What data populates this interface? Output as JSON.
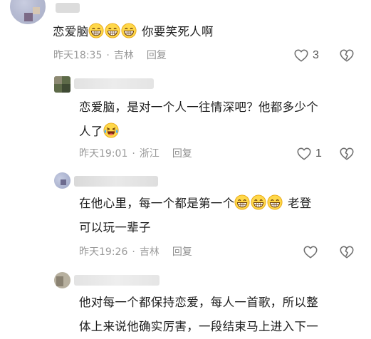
{
  "comments": [
    {
      "content_pre": "恋爱脑",
      "content_post": "你要笑死人啊",
      "time": "昨天18:35",
      "location": "吉林",
      "reply_label": "回复",
      "like_count": "3"
    },
    {
      "line1": "恋爱脑，是对一个人一往情深吧？他都多少个",
      "line2_pre": "人了",
      "time": "昨天19:01",
      "location": "浙江",
      "reply_label": "回复",
      "like_count": "1"
    },
    {
      "line1_pre": "在他心里，每一个都是第一个",
      "line1_post": "老登",
      "line2": "可以玩一辈子",
      "time": "昨天19:26",
      "location": "吉林",
      "reply_label": "回复",
      "like_count": ""
    },
    {
      "line1": "他对每一个都保持恋爱，每人一首歌，所以整",
      "line2": "体上来说他确实厉害，一段结束马上进入下一"
    }
  ],
  "separator": "·",
  "icons": {
    "like": "heart-outline-icon",
    "dislike": "broken-heart-icon",
    "laugh": "grinning-emoji-icon",
    "tears": "laughing-tears-emoji-icon"
  },
  "colors": {
    "meta": "#9a9a9a",
    "text": "#1c1c1c",
    "icon": "#6f6f6f"
  }
}
